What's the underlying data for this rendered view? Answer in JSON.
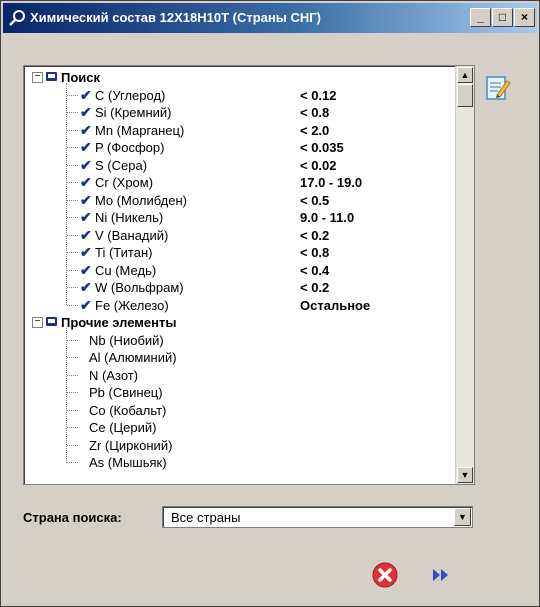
{
  "window": {
    "title": "Химический состав 12Х18Н10Т (Страны СНГ)",
    "controls": {
      "minimize": "_",
      "maximize": "□",
      "close": "×"
    }
  },
  "tree": {
    "groups": [
      {
        "label": "Поиск",
        "expanded": true,
        "items": [
          {
            "name": "C (Углерод)",
            "value": "< 0.12"
          },
          {
            "name": "Si (Кремний)",
            "value": "< 0.8"
          },
          {
            "name": "Mn (Марганец)",
            "value": "< 2.0"
          },
          {
            "name": "P (Фосфор)",
            "value": "< 0.035"
          },
          {
            "name": "S (Сера)",
            "value": "< 0.02"
          },
          {
            "name": "Cr (Хром)",
            "value": "17.0 - 19.0"
          },
          {
            "name": "Mo (Молибден)",
            "value": "< 0.5"
          },
          {
            "name": "Ni (Никель)",
            "value": "9.0 - 11.0"
          },
          {
            "name": "V (Ванадий)",
            "value": "< 0.2"
          },
          {
            "name": "Ti (Титан)",
            "value": "< 0.8"
          },
          {
            "name": "Cu (Медь)",
            "value": "< 0.4"
          },
          {
            "name": "W (Вольфрам)",
            "value": "< 0.2"
          },
          {
            "name": "Fe (Железо)",
            "value": "Остальное"
          }
        ]
      },
      {
        "label": "Прочие элементы",
        "expanded": true,
        "items": [
          {
            "name": "Nb (Ниобий)"
          },
          {
            "name": "Al (Алюминий)"
          },
          {
            "name": "N (Азот)"
          },
          {
            "name": "Pb (Свинец)"
          },
          {
            "name": "Co (Кобальт)"
          },
          {
            "name": "Ce (Церий)"
          },
          {
            "name": "Zr (Цирконий)"
          },
          {
            "name": "As (Мышьяк)"
          }
        ]
      }
    ],
    "expander_symbol": "−"
  },
  "search_country": {
    "label": "Страна поиска:",
    "value": "Все страны"
  },
  "icons": {
    "title": "search-icon",
    "edit": "edit-note-icon",
    "cancel": "cancel-icon",
    "next": "fast-forward-icon",
    "check": "checkmark-icon",
    "folder": "folder-icon"
  },
  "colors": {
    "title_gradient_start": "#0a246a",
    "title_gradient_end": "#a6caf0",
    "check": "#1c2f8a",
    "cancel": "#e0313a",
    "next": "#2a4fc8"
  }
}
